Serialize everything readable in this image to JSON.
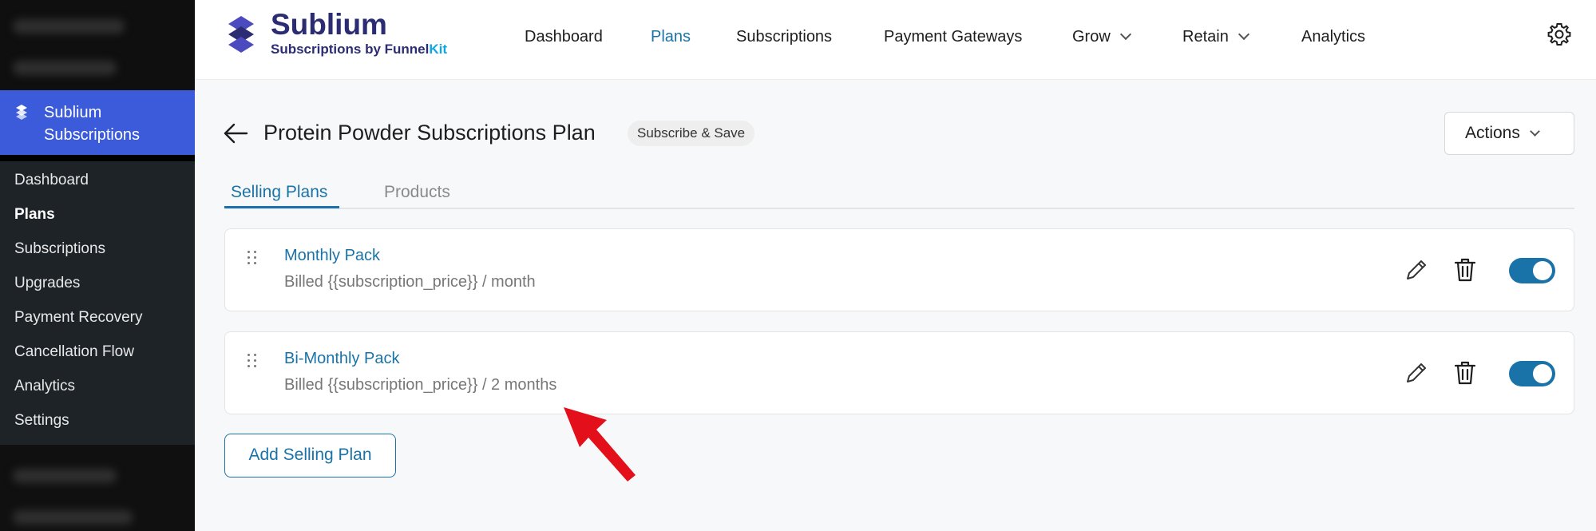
{
  "sidebar": {
    "active_title": "Sublium Subscriptions",
    "items": [
      {
        "label": "Dashboard",
        "active": false
      },
      {
        "label": "Plans",
        "active": true
      },
      {
        "label": "Subscriptions",
        "active": false
      },
      {
        "label": "Upgrades",
        "active": false
      },
      {
        "label": "Payment Recovery",
        "active": false
      },
      {
        "label": "Cancellation Flow",
        "active": false
      },
      {
        "label": "Analytics",
        "active": false
      },
      {
        "label": "Settings",
        "active": false
      }
    ]
  },
  "brand": {
    "name": "Sublium",
    "tagline_prefix": "Subscriptions by Funnel",
    "tagline_suffix": "Kit"
  },
  "topnav": {
    "items": [
      {
        "label": "Dashboard",
        "active": false
      },
      {
        "label": "Plans",
        "active": true
      },
      {
        "label": "Subscriptions",
        "active": false
      },
      {
        "label": "Payment Gateways",
        "active": false
      },
      {
        "label": "Grow",
        "active": false,
        "dropdown": true
      },
      {
        "label": "Retain",
        "active": false,
        "dropdown": true
      },
      {
        "label": "Analytics",
        "active": false
      }
    ],
    "settings_icon": "gear-icon"
  },
  "header": {
    "title": "Protein Powder Subscriptions Plan",
    "badge": "Subscribe & Save",
    "actions_label": "Actions"
  },
  "tabs": [
    {
      "label": "Selling Plans",
      "active": true
    },
    {
      "label": "Products",
      "active": false
    }
  ],
  "plans": [
    {
      "name": "Monthly Pack",
      "description": "Billed {{subscription_price}} / month",
      "enabled": true
    },
    {
      "name": "Bi-Monthly Pack",
      "description": "Billed {{subscription_price}} / 2 months",
      "enabled": true
    }
  ],
  "add_plan_label": "Add Selling Plan",
  "colors": {
    "accent": "#1a73a8",
    "sidebar_active": "#3b5bdb",
    "brand": "#2c2c73",
    "annotation_arrow": "#e3101b"
  }
}
